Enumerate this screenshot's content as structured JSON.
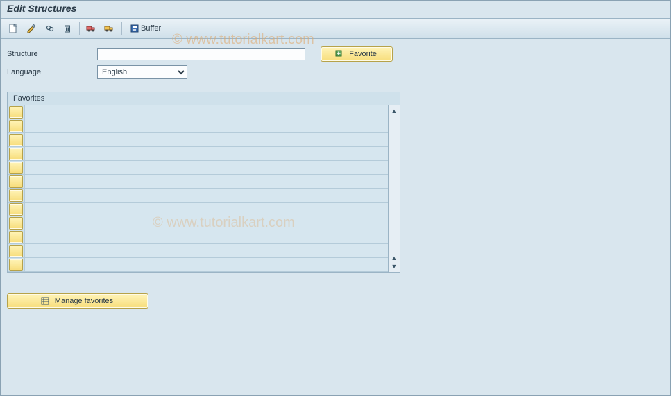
{
  "header": {
    "title": "Edit Structures"
  },
  "toolbar": {
    "icons": {
      "create": "create-icon",
      "change": "change-icon",
      "display": "display-icon",
      "delete": "delete-icon",
      "transport": "transport-icon",
      "truck": "truck-icon",
      "buffer": "buffer-icon"
    },
    "buffer_label": "Buffer"
  },
  "form": {
    "structure_label": "Structure",
    "structure_value": "",
    "language_label": "Language",
    "language_value": "English",
    "language_options": [
      "English"
    ]
  },
  "buttons": {
    "favorite": "Favorite",
    "manage_favorites": "Manage favorites"
  },
  "favorites": {
    "panel_title": "Favorites",
    "rows": [
      "",
      "",
      "",
      "",
      "",
      "",
      "",
      "",
      "",
      "",
      "",
      ""
    ]
  },
  "watermark": "© www.tutorialkart.com"
}
